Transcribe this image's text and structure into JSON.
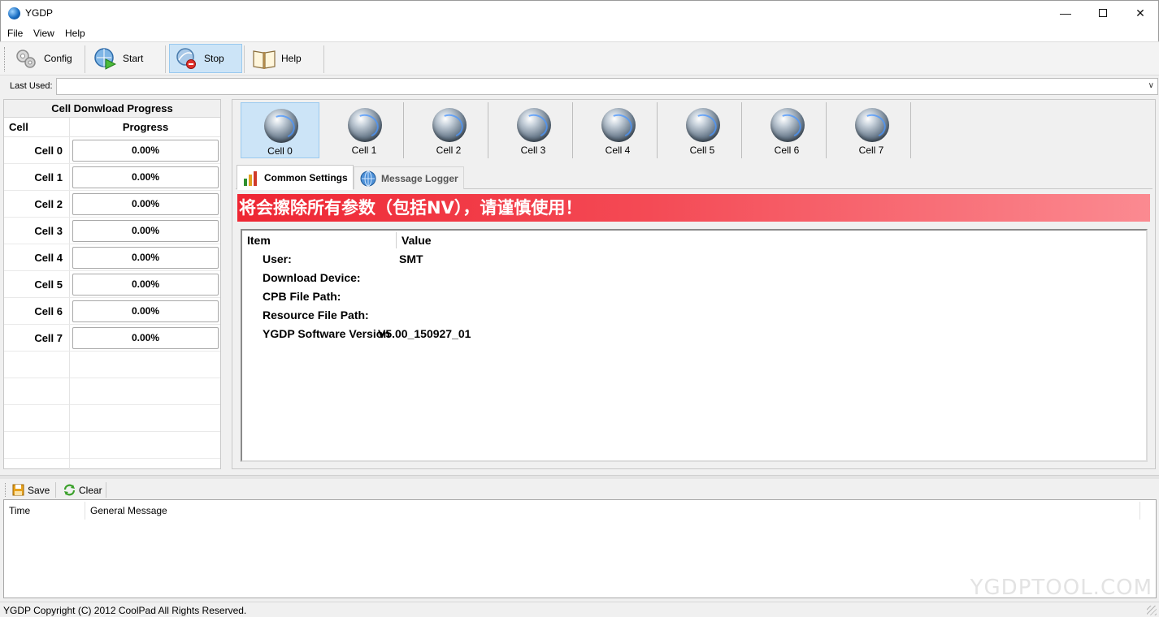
{
  "window": {
    "title": "YGDP"
  },
  "menu": [
    "File",
    "View",
    "Help"
  ],
  "toolbar": {
    "config_label": "Config",
    "start_label": "Start",
    "stop_label": "Stop",
    "help_label": "Help",
    "active": "Stop"
  },
  "last_used": {
    "label": "Last Used:",
    "value": ""
  },
  "progress_panel": {
    "title": "Cell Donwload Progress",
    "col_cell": "Cell",
    "col_progress": "Progress",
    "rows": [
      {
        "cell": "Cell 0",
        "progress": "0.00%"
      },
      {
        "cell": "Cell 1",
        "progress": "0.00%"
      },
      {
        "cell": "Cell 2",
        "progress": "0.00%"
      },
      {
        "cell": "Cell 3",
        "progress": "0.00%"
      },
      {
        "cell": "Cell 4",
        "progress": "0.00%"
      },
      {
        "cell": "Cell 5",
        "progress": "0.00%"
      },
      {
        "cell": "Cell 6",
        "progress": "0.00%"
      },
      {
        "cell": "Cell 7",
        "progress": "0.00%"
      }
    ]
  },
  "cells": [
    "Cell 0",
    "Cell 1",
    "Cell 2",
    "Cell 3",
    "Cell 4",
    "Cell 5",
    "Cell 6",
    "Cell 7"
  ],
  "selected_cell": "Cell 0",
  "tabs": [
    {
      "label": "Common Settings",
      "icon": "bar-chart-icon",
      "active": true
    },
    {
      "label": "Message Logger",
      "icon": "globe-icon",
      "active": false
    }
  ],
  "warning_banner": "将会擦除所有参数（包括NV），请谨慎使用！",
  "settings_grid": {
    "col_item": "Item",
    "col_value": "Value",
    "rows": [
      {
        "item": "User:",
        "value": "SMT"
      },
      {
        "item": "Download Device:",
        "value": ""
      },
      {
        "item": "CPB File Path:",
        "value": ""
      },
      {
        "item": "Resource File Path:",
        "value": ""
      },
      {
        "item": "YGDP Software Version",
        "value": "V5.00_150927_01"
      }
    ]
  },
  "log_toolbar": {
    "save_label": "Save",
    "clear_label": "Clear"
  },
  "log_list": {
    "col_time": "Time",
    "col_message": "General Message"
  },
  "watermark": "YGDPTOOL.COM",
  "status": "YGDP Copyright (C) 2012 CoolPad All Rights Reserved.",
  "colors": {
    "banner_start": "#ee2633",
    "banner_end": "#fb8a91",
    "active_bg": "#cce4f7"
  }
}
